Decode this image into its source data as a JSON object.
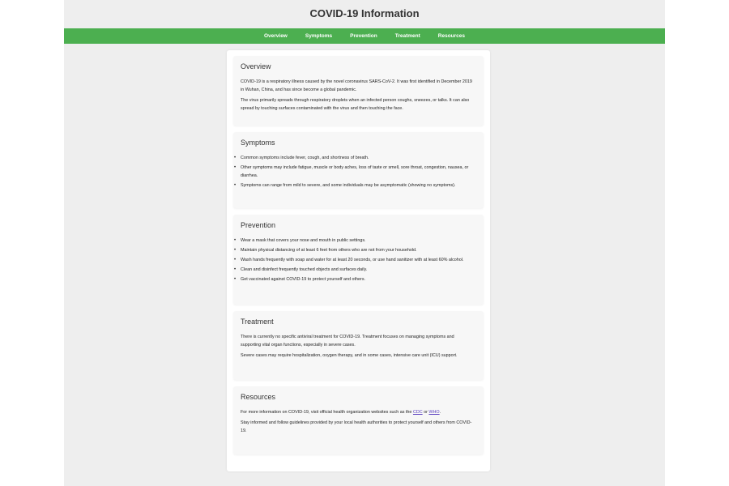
{
  "header": {
    "title": "COVID-19 Information"
  },
  "nav": {
    "items": [
      "Overview",
      "Symptoms",
      "Prevention",
      "Treatment",
      "Resources"
    ]
  },
  "sections": {
    "overview": {
      "title": "Overview",
      "paragraphs": [
        "COVID-19 is a respiratory illness caused by the novel coronavirus SARS-CoV-2. It was first identified in December 2019 in Wuhan, China, and has since become a global pandemic.",
        "The virus primarily spreads through respiratory droplets when an infected person coughs, sneezes, or talks. It can also spread by touching surfaces contaminated with the virus and then touching the face."
      ]
    },
    "symptoms": {
      "title": "Symptoms",
      "items": [
        "Common symptoms include fever, cough, and shortness of breath.",
        "Other symptoms may include fatigue, muscle or body aches, loss of taste or smell, sore throat, congestion, nausea, or diarrhea.",
        "Symptoms can range from mild to severe, and some individuals may be asymptomatic (showing no symptoms)."
      ]
    },
    "prevention": {
      "title": "Prevention",
      "items": [
        "Wear a mask that covers your nose and mouth in public settings.",
        "Maintain physical distancing of at least 6 feet from others who are not from your household.",
        "Wash hands frequently with soap and water for at least 20 seconds, or use hand sanitizer with at least 60% alcohol.",
        "Clean and disinfect frequently touched objects and surfaces daily.",
        "Get vaccinated against COVID-19 to protect yourself and others."
      ]
    },
    "treatment": {
      "title": "Treatment",
      "paragraphs": [
        "There is currently no specific antiviral treatment for COVID-19. Treatment focuses on managing symptoms and supporting vital organ functions, especially in severe cases.",
        "Severe cases may require hospitalization, oxygen therapy, and in some cases, intensive care unit (ICU) support."
      ]
    },
    "resources": {
      "title": "Resources",
      "intro_before": "For more information on COVID-19, visit official health organization websites such as the ",
      "link_cdc": "CDC",
      "intro_between": " or ",
      "link_who": "WHO",
      "intro_after": ".",
      "paragraph2": "Stay informed and follow guidelines provided by your local health authorities to protect yourself and others from COVID-19."
    }
  },
  "colors": {
    "nav_bg": "#4caf50",
    "page_bg": "#eeeeee",
    "card_bg": "#f7f7f7",
    "link": "#5a3fbf"
  }
}
